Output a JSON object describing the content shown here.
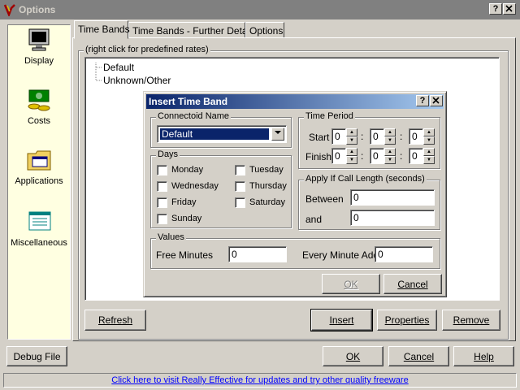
{
  "window": {
    "title": "Options",
    "help_btn": "?",
    "close_btn": "X"
  },
  "sidebar": {
    "items": [
      {
        "label": "Display",
        "icon": "monitor-icon"
      },
      {
        "label": "Costs",
        "icon": "money-icon"
      },
      {
        "label": "Applications",
        "icon": "folder-apps-icon"
      },
      {
        "label": "Miscellaneous",
        "icon": "document-icon"
      }
    ]
  },
  "tabs": [
    {
      "label": "Time Bands",
      "active": true
    },
    {
      "label": "Time Bands - Further Details",
      "active": false
    },
    {
      "label": "Options",
      "active": false
    }
  ],
  "panel": {
    "group_label": "(right click for predefined rates)",
    "tree_items": [
      "Default",
      "Unknown/Other"
    ],
    "buttons": {
      "refresh": "Refresh",
      "insert": "Insert",
      "properties": "Properties",
      "remove": "Remove"
    }
  },
  "dialog": {
    "title": "Insert Time Band",
    "help_btn": "?",
    "close_btn": "X",
    "connectoid": {
      "label": "Connectoid Name",
      "value": "Default"
    },
    "days": {
      "label": "Days",
      "items": [
        "Monday",
        "Tuesday",
        "Wednesday",
        "Thursday",
        "Friday",
        "Saturday",
        "Sunday"
      ]
    },
    "time_period": {
      "label": "Time Period",
      "start_label": "Start",
      "finish_label": "Finish",
      "start": [
        "0",
        "0",
        "0"
      ],
      "finish": [
        "0",
        "0",
        "0"
      ],
      "sep": ":"
    },
    "apply": {
      "label": "Apply If Call Length (seconds)",
      "between_label": "Between",
      "between_value": "0",
      "and_label": "and",
      "and_value": "0"
    },
    "values": {
      "label": "Values",
      "free_minutes_label": "Free Minutes",
      "free_minutes_value": "0",
      "every_minute_label": "Every Minute Add",
      "every_minute_value": "0"
    },
    "ok": "OK",
    "cancel": "Cancel"
  },
  "footer": {
    "debug": "Debug File",
    "ok": "OK",
    "cancel": "Cancel",
    "help": "Help"
  },
  "status": {
    "link": "Click here to visit Really Effective for updates and try other quality freeware"
  }
}
